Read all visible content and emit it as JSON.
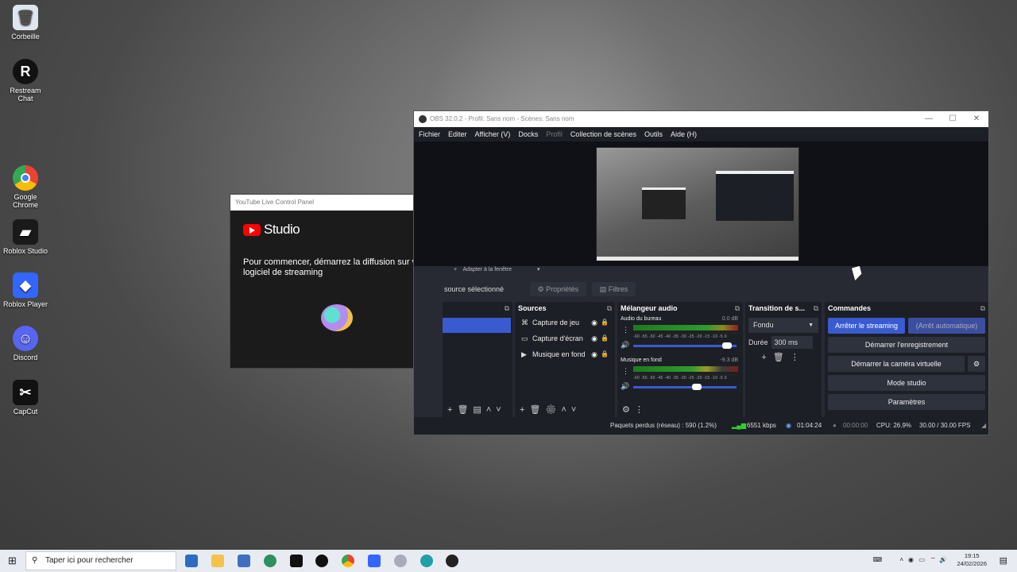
{
  "desktop": {
    "icons": [
      {
        "label": "Corbeille",
        "glyph": "🗑",
        "color": "#dfe6ee"
      },
      {
        "label": "Restream Chat",
        "glyph": "R",
        "color": "#111111"
      },
      {
        "label": "Google Chrome",
        "glyph": "◉",
        "color": "#ffffff"
      },
      {
        "label": "Roblox Studio",
        "glyph": "▰",
        "color": "#1a1a1a"
      },
      {
        "label": "Roblox Player",
        "glyph": "◆",
        "color": "#3366ff"
      },
      {
        "label": "Discord",
        "glyph": "☺",
        "color": "#5865f2"
      },
      {
        "label": "CapCut",
        "glyph": "✂",
        "color": "#111111"
      }
    ]
  },
  "youtube_panel": {
    "window_title": "YouTube Live Control Panel",
    "logo_text": "Studio",
    "message": "Pour commencer, démarrez la diffusion sur votre logiciel de streaming"
  },
  "obs": {
    "window_title": "OBS 32.0.2 - Profil: Sans nom - Scènes: Sans nom",
    "menu": [
      {
        "label": "Fichier",
        "dim": false
      },
      {
        "label": "Editer",
        "dim": false
      },
      {
        "label": "Afficher (V)",
        "dim": false
      },
      {
        "label": "Docks",
        "dim": false
      },
      {
        "label": "Profil",
        "dim": true
      },
      {
        "label": "Collection de scènes",
        "dim": false
      },
      {
        "label": "Outils",
        "dim": false
      },
      {
        "label": "Aide (H)",
        "dim": false
      }
    ],
    "context_bar": {
      "zoom_label": "Adapter à la fenêtre"
    },
    "selection_label": "source sélectionné",
    "properties_label": "Propriétés",
    "filters_label": "Filtres",
    "sources": {
      "title": "Sources",
      "items": [
        {
          "label": "Capture de jeu",
          "icon": "gamepad-icon",
          "glyph": "🎮"
        },
        {
          "label": "Capture d'écran",
          "icon": "monitor-icon",
          "glyph": "▭"
        },
        {
          "label": "Musique en fond",
          "icon": "play-icon",
          "glyph": "▶"
        }
      ]
    },
    "mixer": {
      "title": "Mélangeur audio",
      "scale": "-60 -55 -50 -45 -40 -35 -30 -25 -20 -15 -10 -5 0",
      "channels": [
        {
          "name": "Audio du bureau",
          "db": "0.0 dB",
          "volume": 0.95
        },
        {
          "name": "Musique en fond",
          "db": "-9.3 dB",
          "volume": 0.66
        }
      ]
    },
    "transitions": {
      "title": "Transition de s...",
      "selected": "Fondu",
      "duration_label": "Durée",
      "duration_value": "300 ms"
    },
    "controls": {
      "title": "Commandes",
      "stop_stream": "Arrêter le streaming",
      "auto_stop": "(Arrêt automatique)",
      "start_recording": "Démarrer l'enregistrement",
      "start_virtualcam": "Démarrer la caméra virtuelle",
      "studio_mode": "Mode studio",
      "settings": "Paramètres"
    },
    "status": {
      "dropped": "Paquets perdus (réseau) : 590 (1.2%)",
      "bitrate": "6551 kbps",
      "stream_time": "01:04:24",
      "rec_time": "00:00:00",
      "cpu": "CPU: 26.9%",
      "fps": "30.00 / 30.00 FPS"
    }
  },
  "taskbar": {
    "search_placeholder": "Taper ici pour rechercher",
    "time": "19:15",
    "date": "24/02/2026"
  }
}
